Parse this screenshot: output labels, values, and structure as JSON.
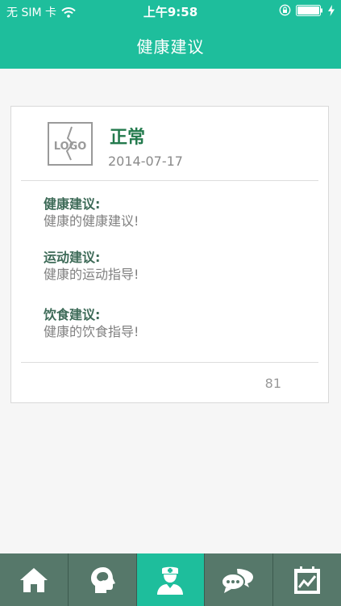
{
  "status_bar": {
    "carrier": "无 SIM 卡",
    "time": "上午9:58"
  },
  "nav": {
    "title": "健康建议"
  },
  "card": {
    "logo_text": "LOGO",
    "status": "正常",
    "date": "2014-07-17",
    "sections": [
      {
        "title": "健康建议:",
        "text": "健康的健康建议!"
      },
      {
        "title": "运动建议:",
        "text": "健康的运动指导!"
      },
      {
        "title": "饮食建议:",
        "text": "健康的饮食指导!"
      }
    ],
    "count": "81"
  },
  "tab_bar": {
    "active_index": 2,
    "tabs": [
      {
        "icon": "home-icon"
      },
      {
        "icon": "head-brain-icon"
      },
      {
        "icon": "doctor-icon"
      },
      {
        "icon": "chat-bubbles-icon"
      },
      {
        "icon": "chart-trend-icon"
      }
    ]
  },
  "colors": {
    "accent": "#1ebe9c",
    "tab_bar": "#56786a",
    "status_text": "#237a4d"
  }
}
